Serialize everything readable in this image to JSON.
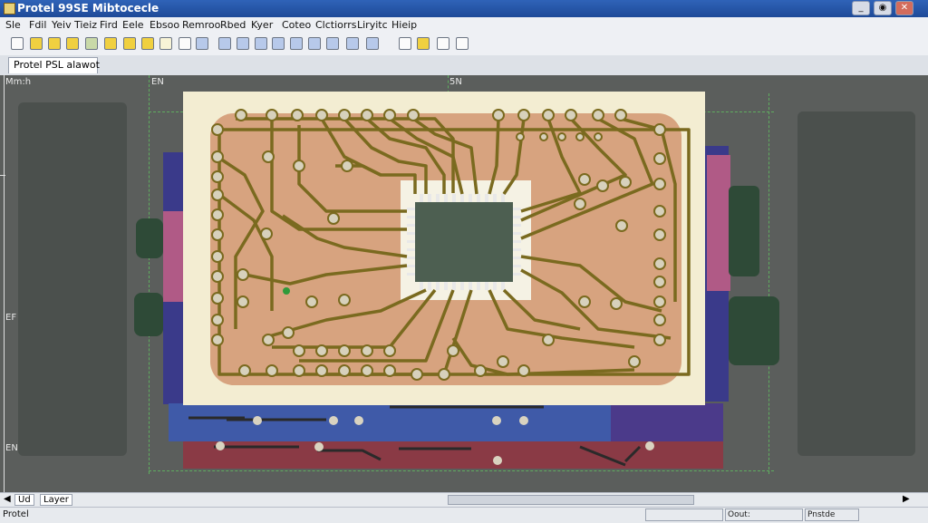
{
  "window": {
    "title": "Protel 99SE Mibtocecle"
  },
  "menu": [
    "Sle",
    "Fdil",
    "Yeiv",
    "Tieiz",
    "Fird",
    "Eele",
    "Ebsoo",
    "Remroo",
    "Rbed",
    "Kyer",
    "Coteo",
    "Clctiorrs",
    "Liryitc",
    "Hieip"
  ],
  "tabs": {
    "document": "Protel PSL alawot"
  },
  "rulers": {
    "top_left": "Mm:h",
    "top_mark_1": "EN",
    "top_mark_2": "5N",
    "left_mark_1": "EF",
    "left_mark_2": "EN"
  },
  "bottom_tabs": {
    "tab1": "Ud",
    "tab2": "Layer"
  },
  "status": {
    "left": "Protel",
    "cell1": "Oout:",
    "cell2": "Pnstde"
  },
  "colors": {
    "board_copper": "#d7a37f",
    "trace": "#7a6a1f",
    "bottom_layer": "#3f5aa8",
    "keepout": "#8a3a45",
    "ic_body": "#4d5f51",
    "sidebar_purple": "#3a3a8a"
  }
}
